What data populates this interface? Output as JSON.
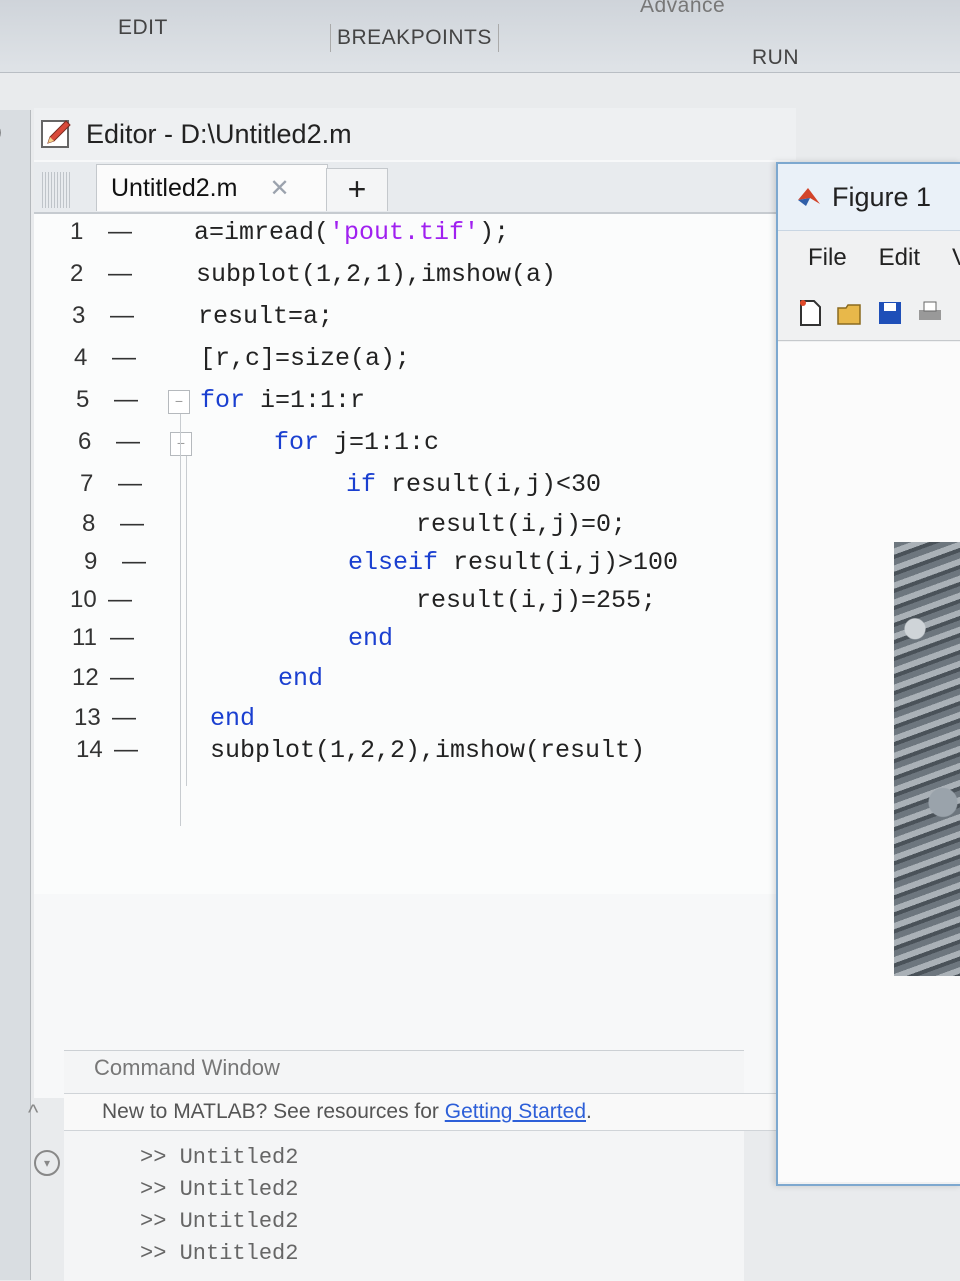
{
  "toolstrip": {
    "tabs": [
      "Advance",
      "EDIT",
      "BREAKPOINTS",
      "RUN"
    ]
  },
  "editor": {
    "title": "Editor - D:\\Untitled2.m",
    "tab_name": "Untitled2.m",
    "add_tab": "+",
    "lines": [
      {
        "no": "1",
        "parts": [
          {
            "t": "a=imread(",
            "c": "plain"
          },
          {
            "t": "'pout.tif'",
            "c": "str"
          },
          {
            "t": ");",
            "c": "plain"
          }
        ]
      },
      {
        "no": "2",
        "parts": [
          {
            "t": "subplot(1,2,1),imshow(a)",
            "c": "plain"
          }
        ]
      },
      {
        "no": "3",
        "parts": [
          {
            "t": "result=a;",
            "c": "plain"
          }
        ]
      },
      {
        "no": "4",
        "parts": [
          {
            "t": "[r,c]=size(a);",
            "c": "plain"
          }
        ]
      },
      {
        "no": "5",
        "parts": [
          {
            "t": "for",
            "c": "kw"
          },
          {
            "t": " i=1:1:r",
            "c": "plain"
          }
        ]
      },
      {
        "no": "6",
        "parts": [
          {
            "t": "for",
            "c": "kw"
          },
          {
            "t": " j=1:1:c",
            "c": "plain"
          }
        ]
      },
      {
        "no": "7",
        "parts": [
          {
            "t": "if",
            "c": "kw"
          },
          {
            "t": " result(i,j)<30",
            "c": "plain"
          }
        ]
      },
      {
        "no": "8",
        "parts": [
          {
            "t": "result(i,j)=0;",
            "c": "plain"
          }
        ]
      },
      {
        "no": "9",
        "parts": [
          {
            "t": "elseif",
            "c": "kw"
          },
          {
            "t": " result(i,j)>100",
            "c": "plain"
          }
        ]
      },
      {
        "no": "10",
        "parts": [
          {
            "t": "result(i,j)=255;",
            "c": "plain"
          }
        ]
      },
      {
        "no": "11",
        "parts": [
          {
            "t": "end",
            "c": "kw"
          }
        ]
      },
      {
        "no": "12",
        "parts": [
          {
            "t": "end",
            "c": "kw"
          }
        ]
      },
      {
        "no": "13",
        "parts": [
          {
            "t": "end",
            "c": "kw"
          }
        ]
      },
      {
        "no": "14",
        "parts": [
          {
            "t": "subplot(1,2,2),imshow(result)",
            "c": "plain"
          }
        ]
      }
    ]
  },
  "command_window": {
    "title": "Command Window",
    "notice_text": "New to MATLAB? See resources for ",
    "notice_link": "Getting Started",
    "notice_end": ".",
    "history": [
      ">> Untitled2",
      ">> Untitled2",
      ">> Untitled2",
      ">> Untitled2"
    ]
  },
  "figure": {
    "title": "Figure 1",
    "menu": [
      "File",
      "Edit",
      "V"
    ],
    "toolbar_icons": [
      "new-figure-icon",
      "open-folder-icon",
      "save-icon",
      "print-icon"
    ],
    "colors": {
      "save": "#1f4fb8",
      "folder": "#e8b84a",
      "new": "#ffffff",
      "frame": "#7da8cf"
    }
  }
}
